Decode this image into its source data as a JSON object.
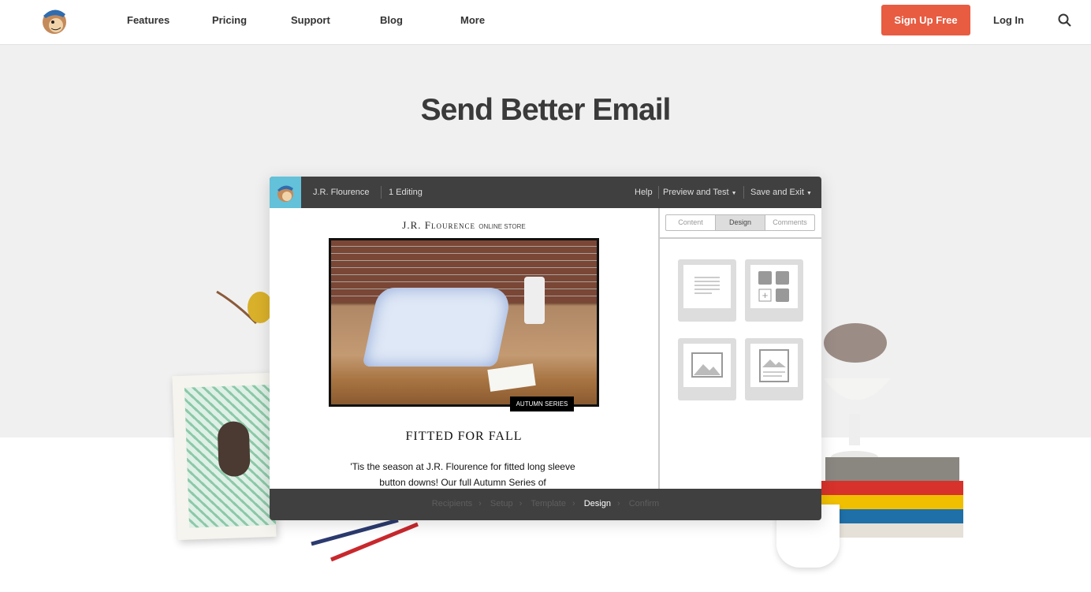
{
  "nav": {
    "links": [
      "Features",
      "Pricing",
      "Support",
      "Blog",
      "More"
    ],
    "signup": "Sign Up Free",
    "login": "Log In"
  },
  "hero": {
    "title": "Send Better Email"
  },
  "app": {
    "account": "J.R. Flourence",
    "editing": "1 Editing",
    "menu": {
      "help": "Help",
      "preview": "Preview and Test",
      "save": "Save and Exit"
    },
    "email": {
      "store": "J.R. Flourence",
      "store_suffix": "ONLINE STORE",
      "badge": "AUTUMN SERIES",
      "heading": "FITTED FOR FALL",
      "body": "'Tis the season at J.R. Flourence for fitted long sleeve button downs! Our full Autumn Series of"
    },
    "tabs": [
      "Content",
      "Design",
      "Comments"
    ],
    "active_tab": "Design",
    "blocks": [
      "text-block-icon",
      "social-block-icon",
      "image-block-icon",
      "image-card-block-icon"
    ],
    "steps": [
      "Recipients",
      "Setup",
      "Template",
      "Design",
      "Confirm"
    ],
    "active_step": "Design"
  },
  "colors": {
    "accent": "#e85c41",
    "topbar": "#404040",
    "logo_bg": "#63c1d9"
  }
}
